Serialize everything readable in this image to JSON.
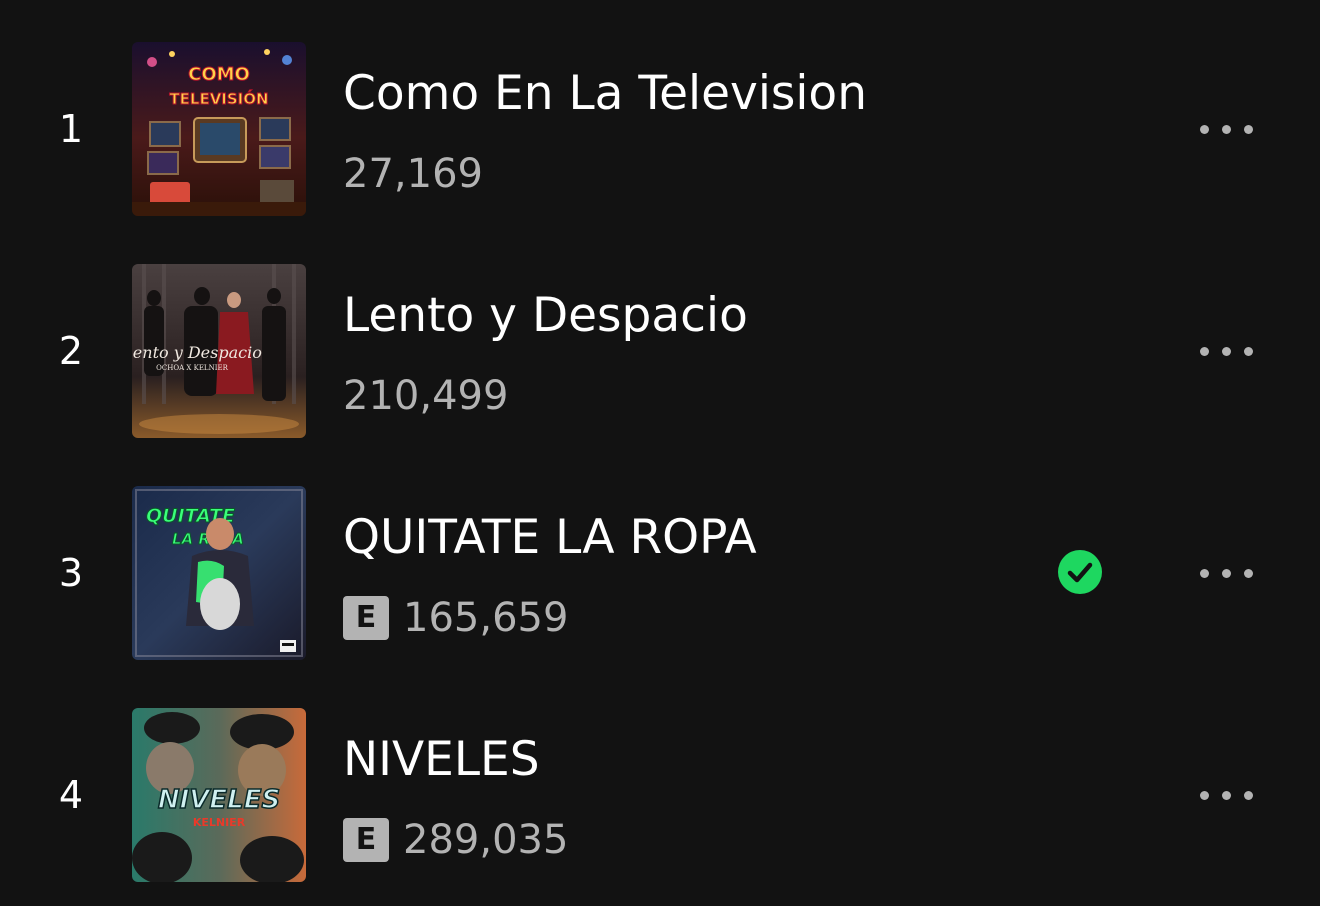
{
  "tracks": [
    {
      "rank": "1",
      "title": "Como En La Television",
      "plays": "27,169",
      "explicit": false,
      "saved": false,
      "cover_text": "COMO EN LA TELEVISIÓN"
    },
    {
      "rank": "2",
      "title": "Lento y Despacio",
      "plays": "210,499",
      "explicit": false,
      "saved": false,
      "cover_text": "Lento y Despacio"
    },
    {
      "rank": "3",
      "title": "QUITATE LA ROPA",
      "plays": "165,659",
      "explicit": true,
      "saved": true,
      "cover_text": "QUITATE LA ROPA"
    },
    {
      "rank": "4",
      "title": "NIVELES",
      "plays": "289,035",
      "explicit": true,
      "saved": false,
      "cover_text": "NIVELES"
    }
  ],
  "explicit_label": "E",
  "colors": {
    "background": "#121212",
    "primary_text": "#ffffff",
    "secondary_text": "#b3b3b3",
    "saved_green": "#1ed760"
  },
  "icons": {
    "saved": "check-circle-icon",
    "more": "more-horizontal-icon"
  }
}
